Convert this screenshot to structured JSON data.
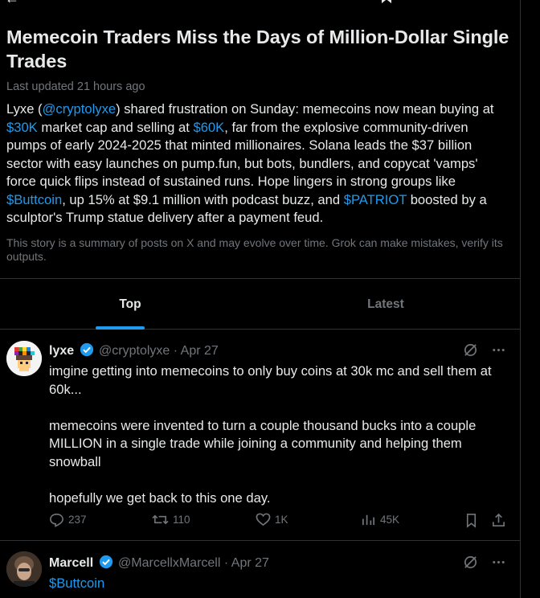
{
  "header": {
    "icons": [
      "back-arrow-icon",
      "bookmark-icon",
      "share-icon",
      "more-icon"
    ]
  },
  "story": {
    "title": "Memecoin Traders Miss the Days of Million-Dollar Single Trades",
    "updated": "Last updated 21 hours ago",
    "summary": {
      "p1": "Lyxe (",
      "handle": "@cryptolyxe",
      "p2": ") shared frustration on Sunday: memecoins now mean buying at ",
      "buy_price": "$30K",
      "p3": " market cap and selling at ",
      "sell_price": "$60K",
      "p4": ", far from the explosive community-driven pumps of early 2024-2025 that minted millionaires. Solana leads the $37 billion sector with easy launches on pump.fun, but bots, bundlers, and copycat 'vamps' force quick flips instead of sustained runs. Hope lingers in strong groups like ",
      "ticker1": "$Buttcoin",
      "p5": ", up 15% at $9.1 million with podcast buzz, and ",
      "ticker2": "$PATRIOT",
      "p6": " boosted by a sculptor's Trump statue delivery after a payment feud."
    },
    "disclaimer": "This story is a summary of posts on X and may evolve over time. Grok can make mistakes, verify its outputs."
  },
  "tabs": [
    {
      "label": "Top",
      "active": true
    },
    {
      "label": "Latest",
      "active": false
    }
  ],
  "posts": [
    {
      "name": "lyxe",
      "handle": "@cryptolyxe",
      "sep": "·",
      "date": "Apr 27",
      "lines": [
        "imgine getting into memecoins to only buy coins at 30k mc and sell them at 60k...",
        "memecoins were invented to turn a couple thousand bucks into a couple MILLION in a single trade while joining a community and helping them snowball",
        "hopefully we get back to this one day."
      ],
      "replies": "237",
      "reposts": "110",
      "likes": "1K",
      "views": "45K"
    },
    {
      "name": "Marcell",
      "handle": "@MarcellxMarcell",
      "sep": "·",
      "date": "Apr 27",
      "text": "$Buttcoin"
    }
  ],
  "colors": {
    "accent": "#1d9bf0",
    "background": "#000000",
    "text": "#e7e9ea",
    "muted": "#71767b",
    "border": "#2f3336"
  }
}
